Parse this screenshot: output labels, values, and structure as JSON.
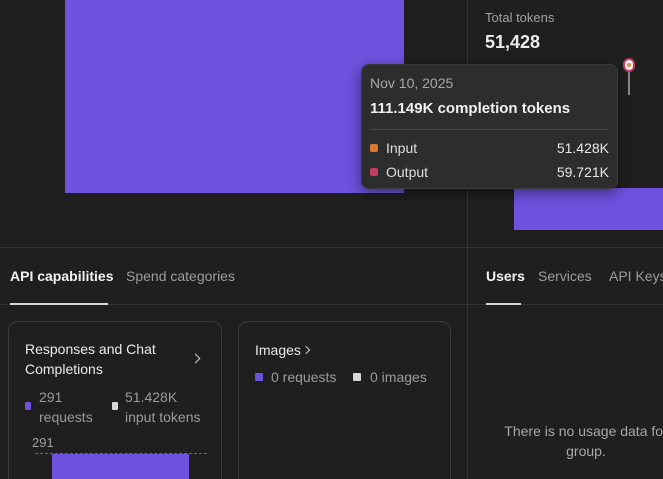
{
  "total_tokens": {
    "label": "Total tokens",
    "value": "51,428"
  },
  "tooltip": {
    "date": "Nov 10, 2025",
    "title": "111.149K completion tokens",
    "rows": [
      {
        "name": "Input",
        "value": "51.428K",
        "color": "#d9772f"
      },
      {
        "name": "Output",
        "value": "59.721K",
        "color": "#c43d62"
      }
    ]
  },
  "left_tabs": [
    {
      "label": "API capabilities",
      "active": true
    },
    {
      "label": "Spend categories",
      "active": false
    }
  ],
  "right_tabs": [
    {
      "label": "Users",
      "active": true
    },
    {
      "label": "Services",
      "active": false
    },
    {
      "label": "API Keys",
      "active": false
    }
  ],
  "cards": [
    {
      "title": "Responses and Chat Completions",
      "legend": [
        {
          "line1": "291",
          "line2": "requests",
          "color": "#6e52de"
        },
        {
          "line1": "51.428K",
          "line2": "input tokens",
          "color": "#d8d8d8"
        }
      ],
      "chart": {
        "max_label": "291"
      }
    },
    {
      "title": "Images",
      "legend": [
        {
          "label": "0 requests",
          "color": "#6e52de"
        },
        {
          "label": "0 images",
          "color": "#d8d8d8"
        }
      ]
    }
  ],
  "users_panel": {
    "empty_message": "There is no usage data for group."
  },
  "colors": {
    "accent": "#6e52de",
    "background": "#1f1f1f",
    "input": "#d9772f",
    "output": "#c43d62"
  }
}
